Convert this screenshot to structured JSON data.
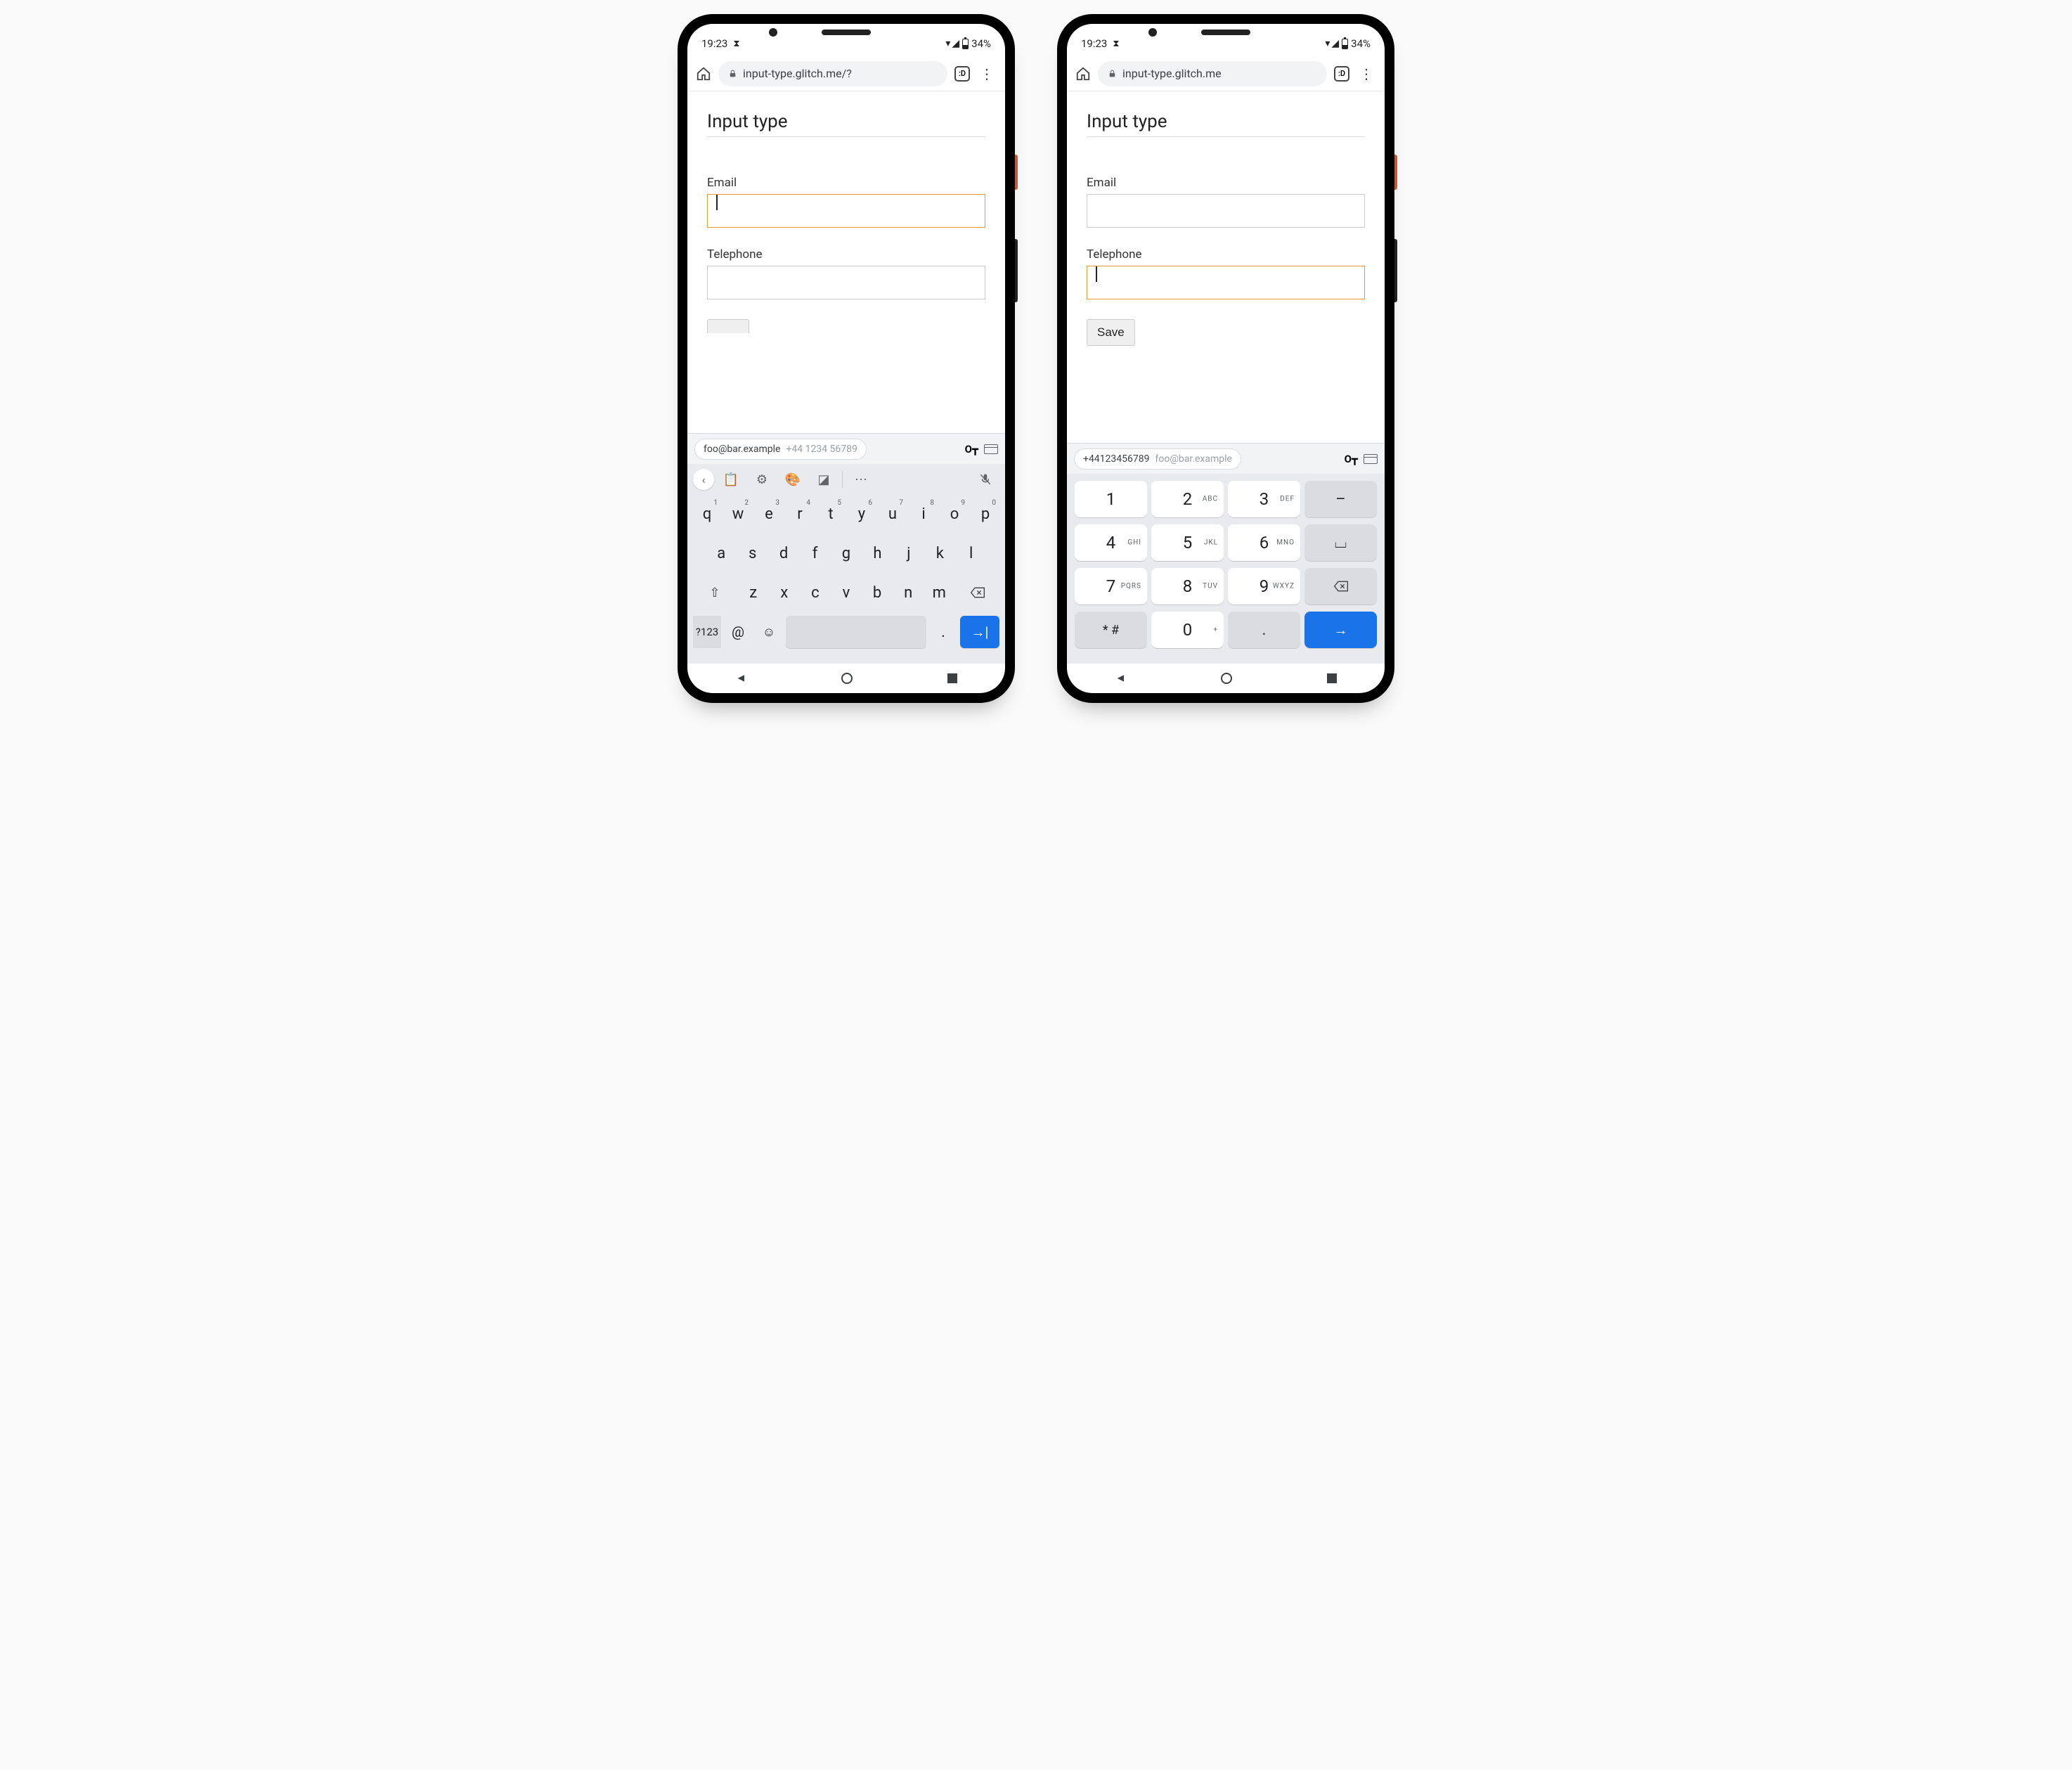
{
  "status": {
    "time": "19:23",
    "battery": "34%"
  },
  "browser": {
    "url_left": "input-type.glitch.me/?",
    "url_right": "input-type.glitch.me",
    "tab_glyph": ":D"
  },
  "page": {
    "title": "Input type",
    "email_label": "Email",
    "tel_label": "Telephone",
    "save_label": "Save"
  },
  "autofill": {
    "email": "foo@bar.example",
    "phone_spaced": "+44 1234 56789",
    "phone_compact": "+44123456789"
  },
  "qwerty": {
    "row1": [
      "q",
      "w",
      "e",
      "r",
      "t",
      "y",
      "u",
      "i",
      "o",
      "p"
    ],
    "row1_super": [
      "1",
      "2",
      "3",
      "4",
      "5",
      "6",
      "7",
      "8",
      "9",
      "0"
    ],
    "row2": [
      "a",
      "s",
      "d",
      "f",
      "g",
      "h",
      "j",
      "k",
      "l"
    ],
    "row3": [
      "z",
      "x",
      "c",
      "v",
      "b",
      "n",
      "m"
    ],
    "sym_key": "?123",
    "at_key": "@",
    "dot_key": "."
  },
  "numpad": {
    "keys": [
      {
        "d": "1",
        "l": ""
      },
      {
        "d": "2",
        "l": "ABC"
      },
      {
        "d": "3",
        "l": "DEF"
      },
      {
        "d": "4",
        "l": "GHI"
      },
      {
        "d": "5",
        "l": "JKL"
      },
      {
        "d": "6",
        "l": "MNO"
      },
      {
        "d": "7",
        "l": "PQRS"
      },
      {
        "d": "8",
        "l": "TUV"
      },
      {
        "d": "9",
        "l": "WXYZ"
      }
    ],
    "star": "* #",
    "zero": "0",
    "plus": "+",
    "dash": "–",
    "space": "⎵",
    "dot": "."
  }
}
